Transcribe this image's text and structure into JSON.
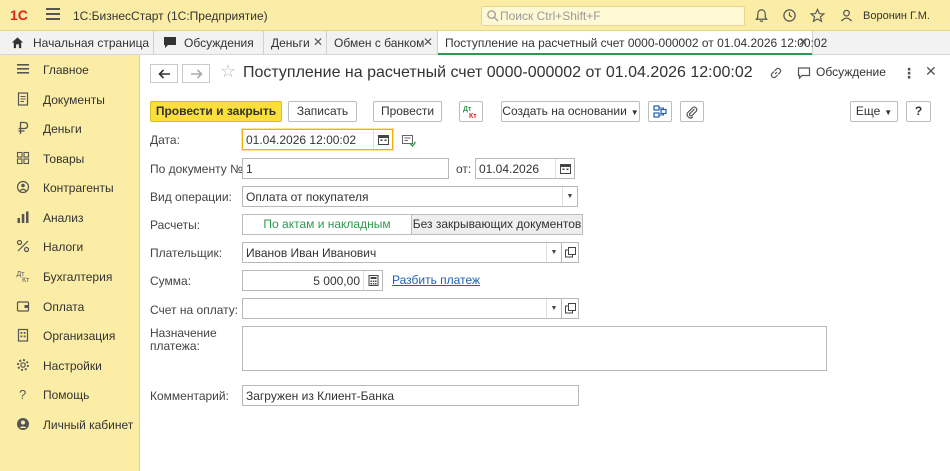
{
  "topbar": {
    "logo": "1С",
    "app_title": "1С:БизнесСтарт  (1С:Предприятие)",
    "search_placeholder": "Поиск Ctrl+Shift+F",
    "user_name": "Воронин Г.М."
  },
  "tabs": [
    {
      "label": "Начальная страница"
    },
    {
      "label": "Обсуждения"
    },
    {
      "label": "Деньги"
    },
    {
      "label": "Обмен с банком"
    },
    {
      "label": "Поступление на расчетный счет 0000-000002 от 01.04.2026 12:00:02"
    }
  ],
  "sidebar": {
    "items": [
      {
        "label": "Главное",
        "icon": "menu-icon"
      },
      {
        "label": "Документы",
        "icon": "document-icon"
      },
      {
        "label": "Деньги",
        "icon": "ruble-icon"
      },
      {
        "label": "Товары",
        "icon": "goods-icon"
      },
      {
        "label": "Контрагенты",
        "icon": "contractors-icon"
      },
      {
        "label": "Анализ",
        "icon": "chart-icon"
      },
      {
        "label": "Налоги",
        "icon": "percent-icon"
      },
      {
        "label": "Бухгалтерия",
        "icon": "accounting-icon"
      },
      {
        "label": "Оплата",
        "icon": "wallet-icon"
      },
      {
        "label": "Организация",
        "icon": "building-icon"
      },
      {
        "label": "Настройки",
        "icon": "gear-icon"
      },
      {
        "label": "Помощь",
        "icon": "help-icon"
      },
      {
        "label": "Личный кабинет",
        "icon": "user-icon"
      }
    ]
  },
  "form": {
    "title": "Поступление на расчетный счет 0000-000002 от 01.04.2026 12:00:02",
    "discussion_label": "Обсуждение",
    "toolbar": {
      "post_close": "Провести и закрыть",
      "save": "Записать",
      "post": "Провести",
      "dtkt": "Дт Кт",
      "create_based": "Создать на основании",
      "more": "Еще",
      "help": "?"
    },
    "fields": {
      "date_label": "Дата:",
      "date_value": "01.04.2026 12:00:02",
      "doc_no_label": "По документу №:",
      "doc_no_value": "1",
      "from_label": "от:",
      "from_value": "01.04.2026",
      "op_type_label": "Вид операции:",
      "op_type_value": "Оплата от покупателя",
      "settlements_label": "Расчеты:",
      "settle_opt1": "По актам и накладным",
      "settle_opt2": "Без закрывающих документов",
      "payer_label": "Плательщик:",
      "payer_value": "Иванов Иван Иванович",
      "amount_label": "Сумма:",
      "amount_value": "5 000,00",
      "split_link": "Разбить платеж",
      "invoice_label": "Счет на оплату:",
      "invoice_value": "",
      "purpose_label_1": "Назначение",
      "purpose_label_2": "платежа:",
      "purpose_value": "",
      "comment_label": "Комментарий:",
      "comment_value": "Загружен из Клиент-Банка"
    }
  },
  "colors": {
    "accent_yellow": "#fcdf3a",
    "panel_yellow": "#fbeca6",
    "active_green": "#2b9a4f",
    "link_blue": "#1f5fb5"
  }
}
